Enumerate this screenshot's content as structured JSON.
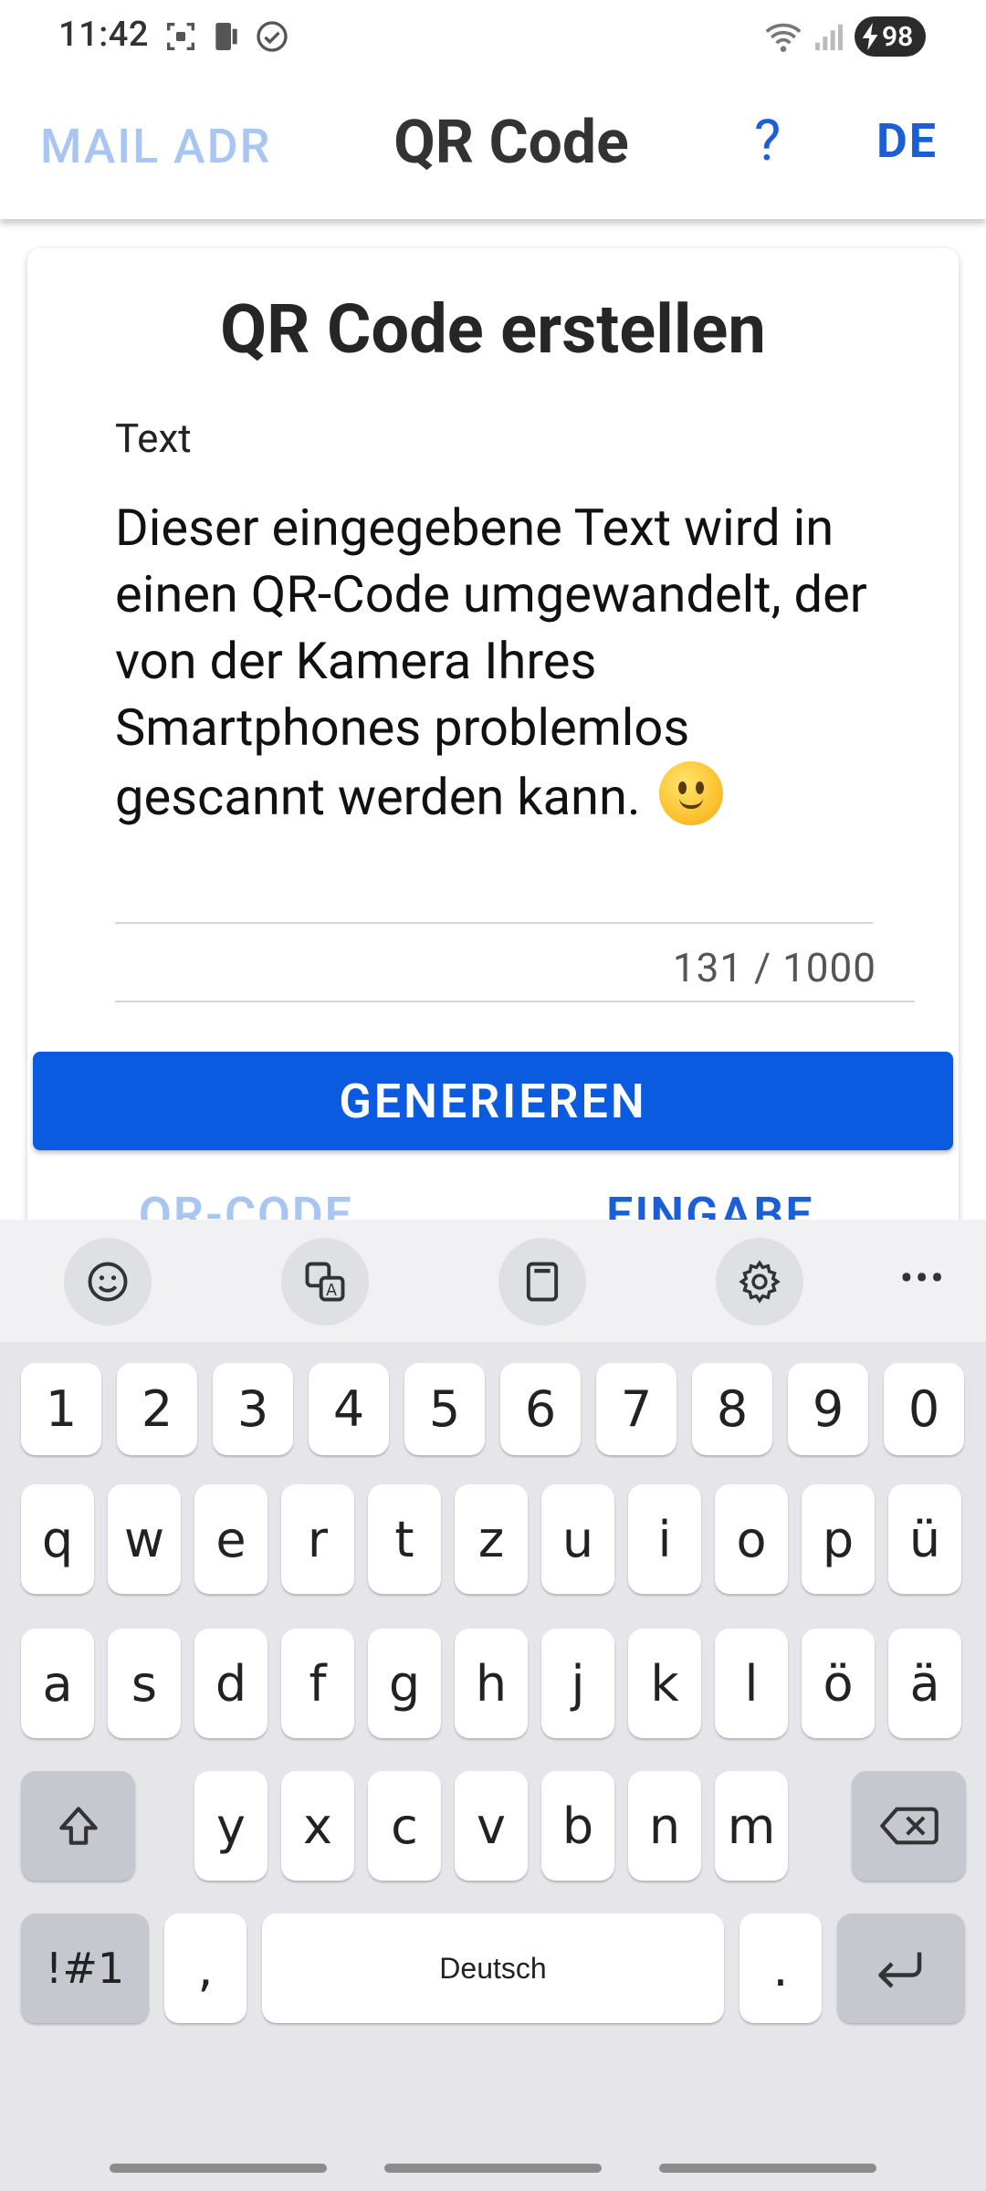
{
  "status_bar": {
    "time": "11:42",
    "battery": "98"
  },
  "app_bar": {
    "left_action": "MAIL ADR",
    "title": "QR Code",
    "help": "?",
    "language": "DE"
  },
  "card": {
    "title": "QR Code erstellen",
    "field_label": "Text",
    "field_value": "Dieser eingegebene Text wird in einen QR-Code umgewandelt, der von der Kamera Ihres Smartphones problemlos gescannt werden kann.",
    "counter": "131 / 1000",
    "generate_label": "GENERIEREN",
    "tab_qr": "QR-CODE",
    "tab_input": "EINGABE"
  },
  "keyboard": {
    "row_numbers": [
      "1",
      "2",
      "3",
      "4",
      "5",
      "6",
      "7",
      "8",
      "9",
      "0"
    ],
    "row_top": [
      "q",
      "w",
      "e",
      "r",
      "t",
      "z",
      "u",
      "i",
      "o",
      "p",
      "ü"
    ],
    "row_mid": [
      "a",
      "s",
      "d",
      "f",
      "g",
      "h",
      "j",
      "k",
      "l",
      "ö",
      "ä"
    ],
    "row_bottom": [
      "y",
      "x",
      "c",
      "v",
      "b",
      "n",
      "m"
    ],
    "symbols_label": "!#1",
    "comma": ",",
    "space_label": "Deutsch",
    "period": "."
  },
  "colors": {
    "accent": "#0a5be0",
    "accent_light": "#a9c5f2",
    "keyboard_bg": "#e6e6ea"
  }
}
